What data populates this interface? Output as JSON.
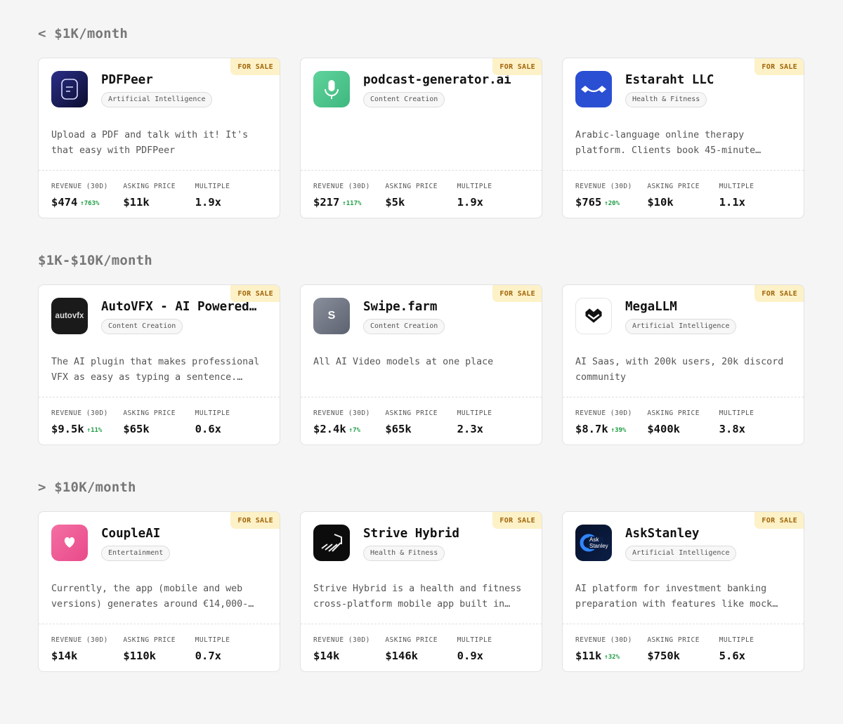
{
  "sections": [
    {
      "title": "< $1K/month",
      "cards": [
        {
          "name": "PDFPeer",
          "category": "Artificial Intelligence",
          "badge": "FOR SALE",
          "description": "Upload a PDF and talk with it! It's that easy with PDFPeer",
          "icon": "pdfpeer-logo",
          "stats": {
            "revenue_label": "REVENUE (30D)",
            "revenue": "$474",
            "growth": "↑763%",
            "asking_label": "ASKING PRICE",
            "asking": "$11k",
            "multiple_label": "MULTIPLE",
            "multiple": "1.9x"
          }
        },
        {
          "name": "podcast-generator.ai",
          "category": "Content Creation",
          "badge": "FOR SALE",
          "description": "",
          "icon": "microphone-logo",
          "stats": {
            "revenue_label": "REVENUE (30D)",
            "revenue": "$217",
            "growth": "↑117%",
            "asking_label": "ASKING PRICE",
            "asking": "$5k",
            "multiple_label": "MULTIPLE",
            "multiple": "1.9x"
          }
        },
        {
          "name": "Estaraht LLC",
          "category": "Health & Fitness",
          "badge": "FOR SALE",
          "description": "Arabic-language online therapy platform. Clients book 45-minute…",
          "icon": "estaraht-logo",
          "stats": {
            "revenue_label": "REVENUE (30D)",
            "revenue": "$765",
            "growth": "↑20%",
            "asking_label": "ASKING PRICE",
            "asking": "$10k",
            "multiple_label": "MULTIPLE",
            "multiple": "1.1x"
          }
        }
      ]
    },
    {
      "title": "$1K-$10K/month",
      "cards": [
        {
          "name": "AutoVFX - AI Powered V…",
          "category": "Content Creation",
          "badge": "FOR SALE",
          "description": "The AI plugin that makes professional VFX as easy as typing a sentence. Work…",
          "icon": "autovfx-logo",
          "logo_text": "autovfx",
          "stats": {
            "revenue_label": "REVENUE (30D)",
            "revenue": "$9.5k",
            "growth": "↑11%",
            "asking_label": "ASKING PRICE",
            "asking": "$65k",
            "multiple_label": "MULTIPLE",
            "multiple": "0.6x"
          }
        },
        {
          "name": "Swipe.farm",
          "category": "Content Creation",
          "badge": "FOR SALE",
          "description": "All AI Video models at one place",
          "icon": "swipe-farm-logo",
          "logo_text": "S",
          "stats": {
            "revenue_label": "REVENUE (30D)",
            "revenue": "$2.4k",
            "growth": "↑7%",
            "asking_label": "ASKING PRICE",
            "asking": "$65k",
            "multiple_label": "MULTIPLE",
            "multiple": "2.3x"
          }
        },
        {
          "name": "MegaLLM",
          "category": "Artificial Intelligence",
          "badge": "FOR SALE",
          "description": "AI Saas, with 200k users, 20k discord community",
          "icon": "megallm-logo",
          "stats": {
            "revenue_label": "REVENUE (30D)",
            "revenue": "$8.7k",
            "growth": "↑39%",
            "asking_label": "ASKING PRICE",
            "asking": "$400k",
            "multiple_label": "MULTIPLE",
            "multiple": "3.8x"
          }
        }
      ]
    },
    {
      "title": "> $10K/month",
      "cards": [
        {
          "name": "CoupleAI",
          "category": "Entertainment",
          "badge": "FOR SALE",
          "description": "Currently, the app (mobile and web versions) generates around €14,000-…",
          "icon": "heart-logo",
          "stats": {
            "revenue_label": "REVENUE (30D)",
            "revenue": "$14k",
            "growth": "",
            "asking_label": "ASKING PRICE",
            "asking": "$110k",
            "multiple_label": "MULTIPLE",
            "multiple": "0.7x"
          }
        },
        {
          "name": "Strive Hybrid",
          "category": "Health & Fitness",
          "badge": "FOR SALE",
          "description": "Strive Hybrid is a health and fitness cross-platform mobile app built in…",
          "icon": "strive-hybrid-logo",
          "stats": {
            "revenue_label": "REVENUE (30D)",
            "revenue": "$14k",
            "growth": "",
            "asking_label": "ASKING PRICE",
            "asking": "$146k",
            "multiple_label": "MULTIPLE",
            "multiple": "0.9x"
          }
        },
        {
          "name": "AskStanley",
          "category": "Artificial Intelligence",
          "badge": "FOR SALE",
          "description": "AI platform for investment banking preparation with features like mock…",
          "icon": "askstanley-logo",
          "logo_text": "Ask Stanley",
          "stats": {
            "revenue_label": "REVENUE (30D)",
            "revenue": "$11k",
            "growth": "↑32%",
            "asking_label": "ASKING PRICE",
            "asking": "$750k",
            "multiple_label": "MULTIPLE",
            "multiple": "5.6x"
          }
        }
      ]
    }
  ],
  "colors": {
    "background": "#f5f5f5",
    "badge_bg": "#fdf1c7",
    "badge_text": "#a0650a",
    "growth": "#1e9d43"
  }
}
